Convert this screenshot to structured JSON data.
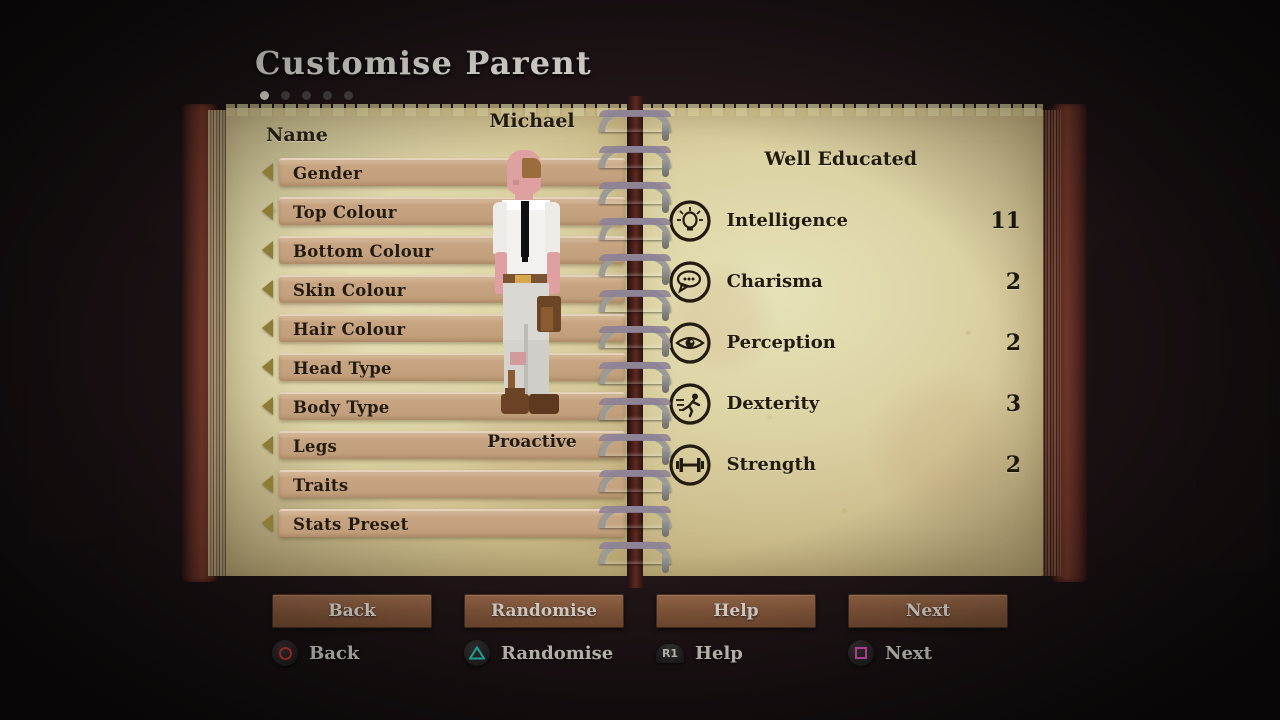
{
  "header": {
    "title": "Customise Parent",
    "page_dots": {
      "total": 5,
      "active_index": 0
    }
  },
  "left_page": {
    "name_label": "Name",
    "options": [
      {
        "label": "Gender",
        "icon_left": "triangle-left-icon",
        "icon_right": "triangle-right-icon"
      },
      {
        "label": "Top Colour",
        "icon_left": "triangle-left-icon",
        "icon_right": "triangle-right-icon"
      },
      {
        "label": "Bottom Colour",
        "icon_left": "triangle-left-icon",
        "icon_right": "triangle-right-icon"
      },
      {
        "label": "Skin Colour",
        "icon_left": "triangle-left-icon",
        "icon_right": "triangle-right-icon"
      },
      {
        "label": "Hair Colour",
        "icon_left": "triangle-left-icon",
        "icon_right": "triangle-right-icon"
      },
      {
        "label": "Head Type",
        "icon_left": "triangle-left-icon",
        "icon_right": "triangle-right-icon"
      },
      {
        "label": "Body Type",
        "icon_left": "triangle-left-icon",
        "icon_right": "triangle-right-icon"
      },
      {
        "label": "Legs",
        "icon_left": "triangle-left-icon",
        "icon_right": "triangle-right-icon"
      },
      {
        "label": "Traits",
        "icon_left": "triangle-left-icon",
        "icon_right": "triangle-right-icon"
      },
      {
        "label": "Stats Preset",
        "icon_left": "triangle-left-icon",
        "icon_right": "triangle-right-icon"
      }
    ]
  },
  "character": {
    "name": "Michael",
    "trait": "Proactive"
  },
  "right_page": {
    "preset_name": "Well Educated",
    "stats": [
      {
        "name": "Intelligence",
        "value": "11",
        "icon": "lightbulb-icon"
      },
      {
        "name": "Charisma",
        "value": "2",
        "icon": "speech-bubble-icon"
      },
      {
        "name": "Perception",
        "value": "2",
        "icon": "eye-icon"
      },
      {
        "name": "Dexterity",
        "value": "3",
        "icon": "running-figure-icon"
      },
      {
        "name": "Strength",
        "value": "2",
        "icon": "dumbbell-icon"
      }
    ]
  },
  "buttons": [
    {
      "label": "Back"
    },
    {
      "label": "Randomise"
    },
    {
      "label": "Help"
    },
    {
      "label": "Next"
    }
  ],
  "prompts": [
    {
      "label": "Back",
      "button": "circle",
      "glyph": "circle-button-icon",
      "color": "#d93b36"
    },
    {
      "label": "Randomise",
      "button": "triangle",
      "glyph": "triangle-button-icon",
      "color": "#25d3bd"
    },
    {
      "label": "Help",
      "button": "R1",
      "glyph": "r1-shoulder-icon",
      "color": "#e0dad4"
    },
    {
      "label": "Next",
      "button": "square",
      "glyph": "square-button-icon",
      "color": "#e754c0"
    }
  ],
  "colors": {
    "background": "#1b1214",
    "page": "#dcd3a4",
    "book_cover": "#7a3a2c",
    "option_box": "#c8a582",
    "arrow": "#8d7c36",
    "ink": "#231a10",
    "button_face": "#8a5c3e"
  }
}
